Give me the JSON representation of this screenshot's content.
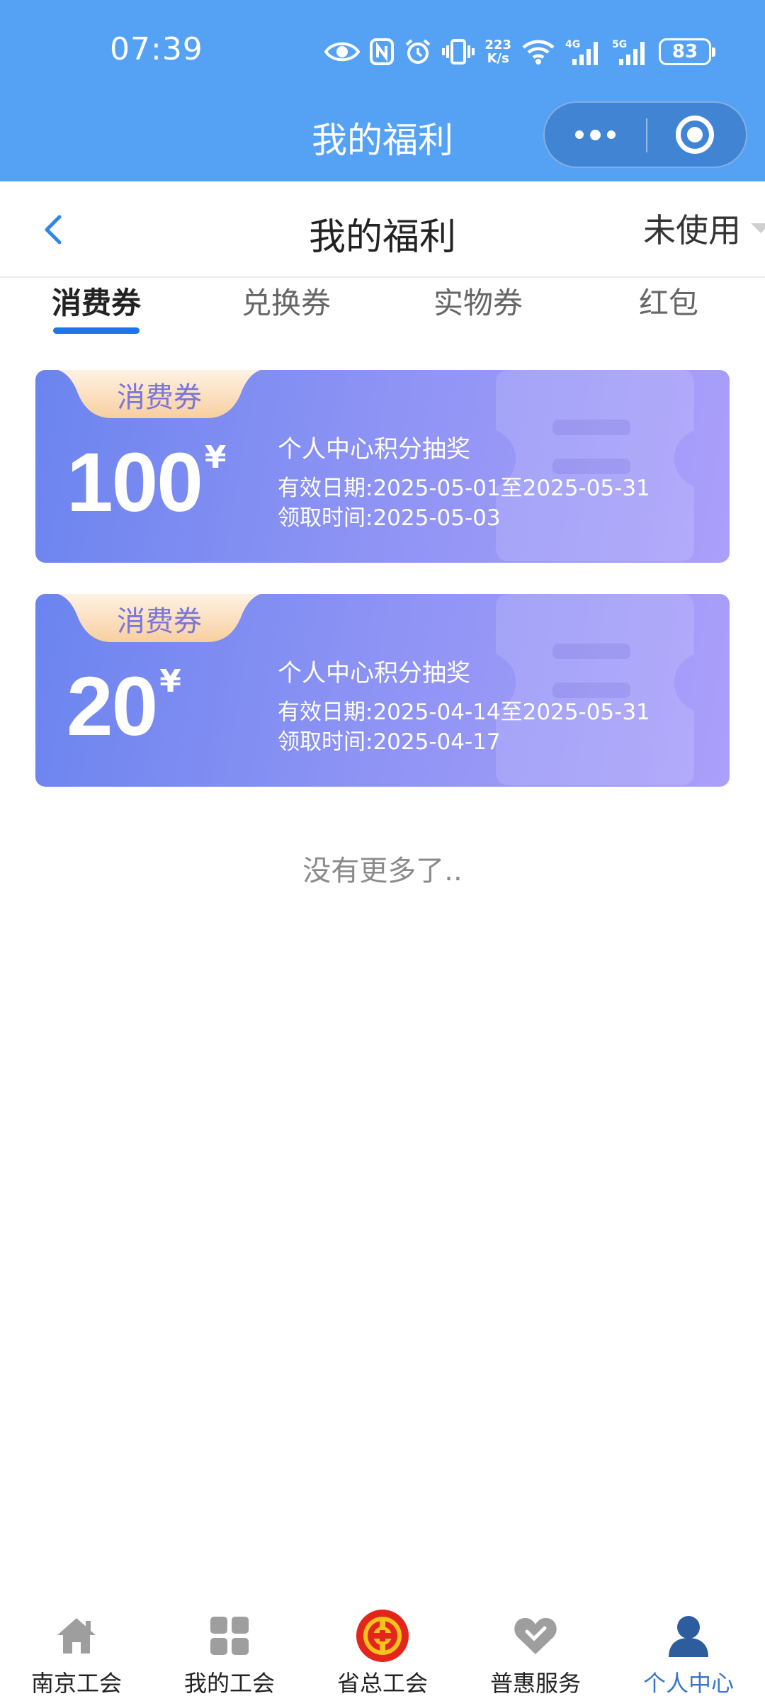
{
  "status_bar": {
    "time": "07:39",
    "network_speed_value": "223",
    "network_speed_unit": "K/s",
    "network_4g": "4G",
    "network_5g": "5G",
    "battery": "83"
  },
  "mini_program": {
    "title": "我的福利"
  },
  "header": {
    "title": "我的福利",
    "status_filter": "未使用"
  },
  "tabs": [
    {
      "label": "消费券",
      "active": true
    },
    {
      "label": "兑换券",
      "active": false
    },
    {
      "label": "实物券",
      "active": false
    },
    {
      "label": "红包",
      "active": false
    }
  ],
  "coupons": [
    {
      "type_label": "消费券",
      "amount": "100",
      "currency": "¥",
      "name": "个人中心积分抽奖",
      "valid_label": "有效日期:",
      "valid_period": "2025-05-01至2025-05-31",
      "received_label": "领取时间:",
      "received_date": "2025-05-03"
    },
    {
      "type_label": "消费券",
      "amount": "20",
      "currency": "¥",
      "name": "个人中心积分抽奖",
      "valid_label": "有效日期:",
      "valid_period": "2025-04-14至2025-05-31",
      "received_label": "领取时间:",
      "received_date": "2025-04-17"
    }
  ],
  "list_end_text": "没有更多了..",
  "bottom_nav": [
    {
      "label": "南京工会",
      "icon": "home-icon",
      "active": false
    },
    {
      "label": "我的工会",
      "icon": "grid-icon",
      "active": false
    },
    {
      "label": "省总工会",
      "icon": "union-emblem-icon",
      "active": false
    },
    {
      "label": "普惠服务",
      "icon": "heart-icon",
      "active": false
    },
    {
      "label": "个人中心",
      "icon": "person-icon",
      "active": true
    }
  ],
  "colors": {
    "header_blue": "#55a2f5",
    "tab_indicator": "#1f76e6",
    "coupon_gradient_start": "#6b84ef",
    "coupon_gradient_end": "#ab9ffb",
    "coupon_tag": "#fbd9b5",
    "nav_active": "#3a75c9",
    "emblem_red": "#e3251b"
  }
}
